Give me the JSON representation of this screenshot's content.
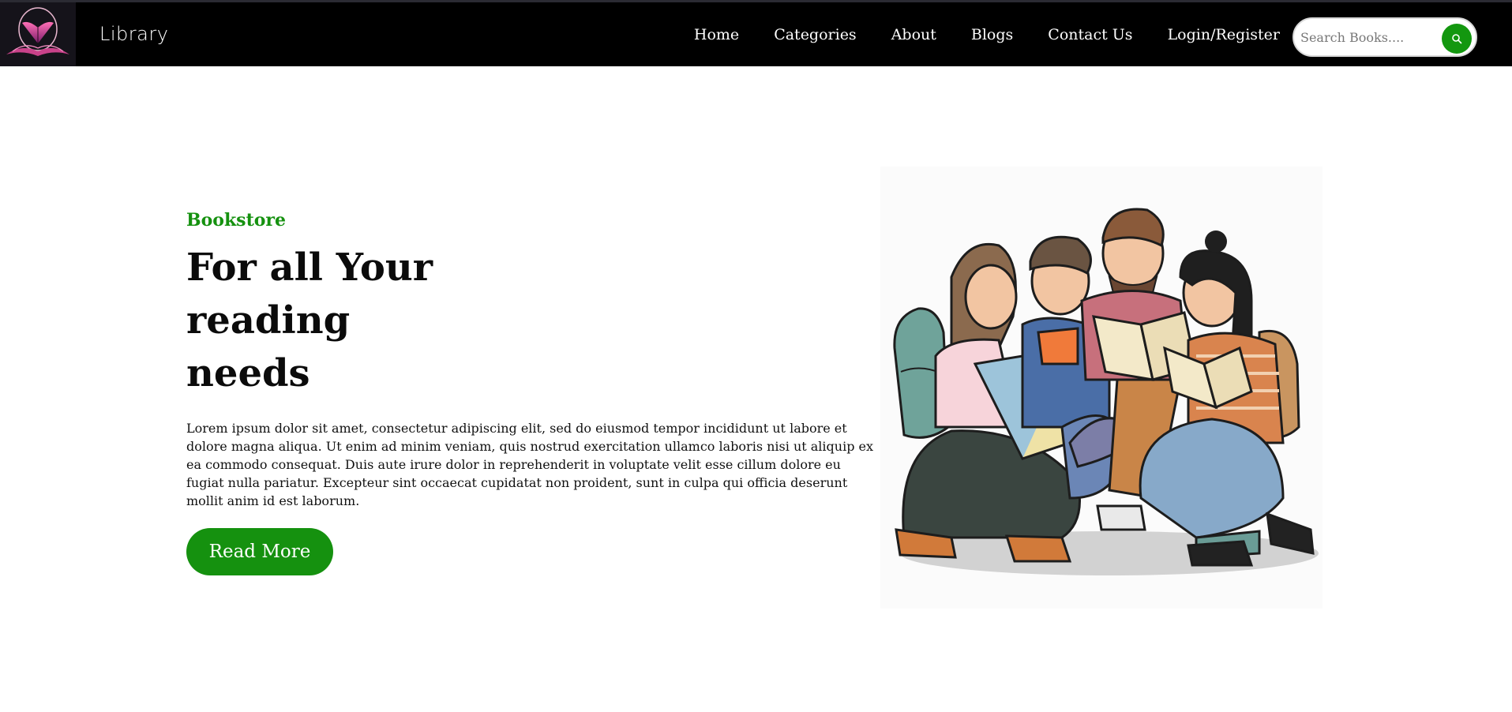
{
  "header": {
    "brand": "Library",
    "nav": [
      "Home",
      "Categories",
      "About",
      "Blogs",
      "Contact Us",
      "Login/Register"
    ],
    "search_placeholder": "Search Books....",
    "logo_icon": "open-book-logo",
    "search_icon": "search-icon"
  },
  "hero": {
    "eyebrow": "Bookstore",
    "headline": "For all Your reading needs",
    "paragraph": "Lorem ipsum dolor sit amet, consectetur adipiscing elit, sed do eiusmod tempor incididunt ut labore et dolore magna aliqua. Ut enim ad minim veniam, quis nostrud exercitation ullamco laboris nisi ut aliquip ex ea commodo consequat. Duis aute irure dolor in reprehenderit in voluptate velit esse cillum dolore eu fugiat nulla pariatur. Excepteur sint occaecat cupidatat non proident, sunt in culpa qui officia deserunt mollit anim id est laborum.",
    "cta_label": "Read More",
    "illustration": "four students reading books"
  },
  "colors": {
    "accent_green": "#15910f",
    "navbar_bg": "#000000",
    "logo_pink": "#d0438d"
  }
}
